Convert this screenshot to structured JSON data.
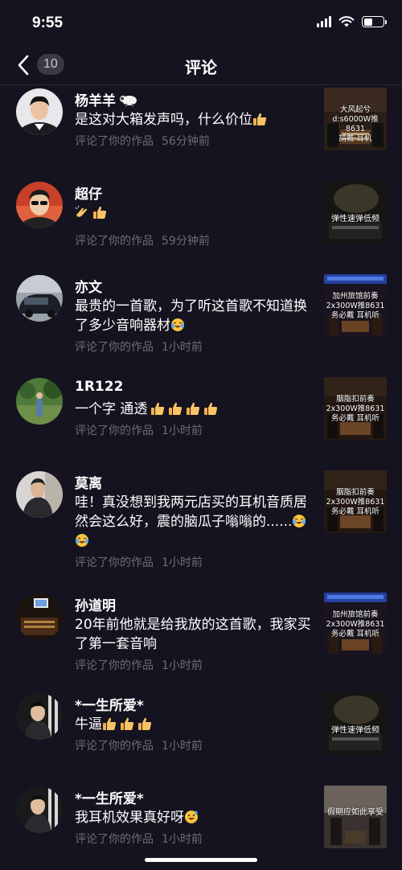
{
  "status_bar": {
    "time": "9:55",
    "battery_level": 0.45
  },
  "nav": {
    "back_icon": "chevron-left-icon",
    "count": "10",
    "title": "评论"
  },
  "colors": {
    "background": "#15131f",
    "meta": "#6e6c78",
    "badge": "#3a3945"
  },
  "comments": [
    {
      "username": "杨羊羊",
      "name_emoji": "sheep",
      "text": "是这对大箱发声吗，什么价位",
      "emojis": [
        "thumbs-up"
      ],
      "action": "评论了你的作品",
      "time": "56分钟前",
      "thumb_text": "大风起兮\nd:s6000W推8631\n請戴  耳机"
    },
    {
      "username": "超仔",
      "text": "",
      "emojis": [
        "clap",
        "thumbs-up"
      ],
      "action": "评论了你的作品",
      "time": "59分钟前",
      "thumb_text": "弹性速弹低频"
    },
    {
      "username": "亦文",
      "text": "最贵的一首歌，为了听这首歌不知道换了多少音响器材",
      "emojis": [
        "laugh-cry"
      ],
      "action": "评论了你的作品",
      "time": "1小时前",
      "thumb_text": "加州旅馆前奏\n2x300W推8631\n务必戴  耳机听"
    },
    {
      "username": "1R122",
      "text": "一个字 通透",
      "emojis": [
        "thumbs-up",
        "thumbs-up",
        "thumbs-up",
        "thumbs-up"
      ],
      "action": "评论了你的作品",
      "time": "1小时前",
      "thumb_text": "胭脂扣前奏\n2x300W推8631\n务必戴  耳机听"
    },
    {
      "username": "莫离",
      "text": "哇！真没想到我两元店买的耳机音质居然会这么好，震的脑瓜子嗡嗡的......",
      "emojis": [
        "laugh-cry",
        "laugh-cry"
      ],
      "action": "评论了你的作品",
      "time": "1小时前",
      "thumb_text": "胭脂扣前奏\n2x300W推8631\n务必戴  耳机听"
    },
    {
      "username": "孙道明",
      "text": "20年前他就是给我放的这首歌，我家买了第一套音响",
      "emojis": [],
      "action": "评论了你的作品",
      "time": "1小时前",
      "thumb_text": "加州旅馆前奏\n2x300W推8631\n务必戴  耳机听"
    },
    {
      "username": "*一生所爱*",
      "text": "牛逼",
      "emojis": [
        "thumbs-up",
        "thumbs-up",
        "thumbs-up"
      ],
      "action": "评论了你的作品",
      "time": "1小时前",
      "thumb_text": "弹性速弹低频"
    },
    {
      "username": "*一生所爱*",
      "text": "我耳机效果真好呀",
      "emojis": [
        "grin-sweat"
      ],
      "action": "评论了你的作品",
      "time": "1小时前",
      "thumb_text": "假期应如此享受"
    }
  ]
}
